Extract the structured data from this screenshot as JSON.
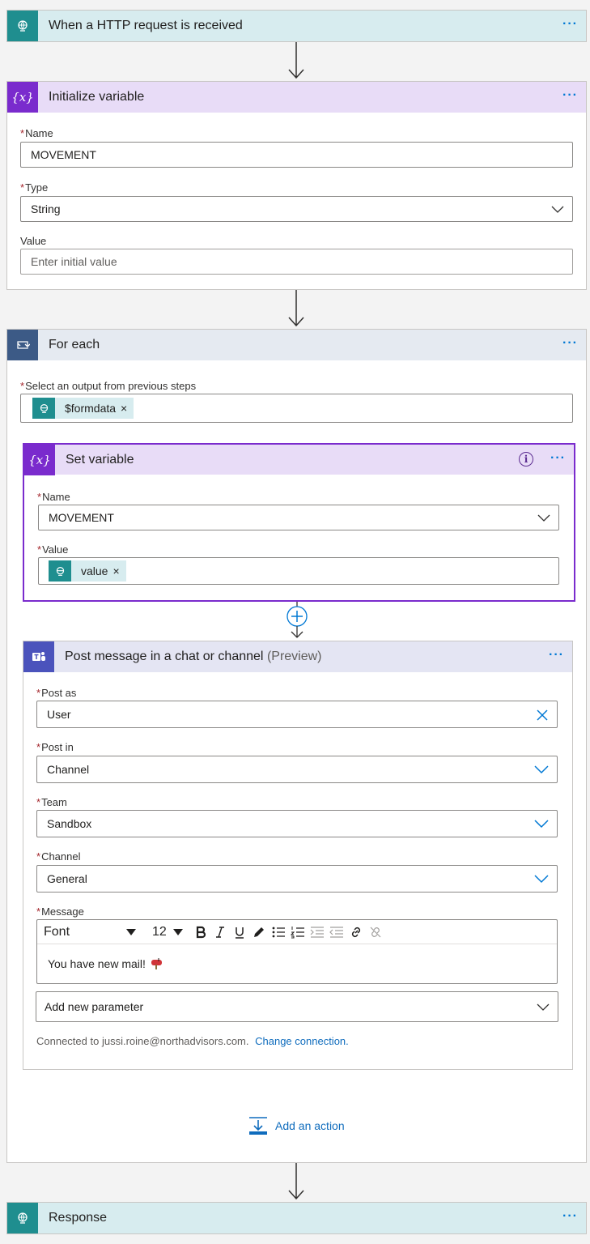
{
  "trigger": {
    "title": "When a HTTP request is received",
    "icon": "http-globe-icon"
  },
  "init_var": {
    "title": "Initialize variable",
    "icon_text": "{x}",
    "name_label": "Name",
    "name_value": "MOVEMENT",
    "type_label": "Type",
    "type_value": "String",
    "value_label": "Value",
    "value_placeholder": "Enter initial value"
  },
  "foreach": {
    "title": "For each",
    "select_label": "Select an output from previous steps",
    "token": "$formdata",
    "add_action": "Add an action"
  },
  "set_var": {
    "title": "Set variable",
    "icon_text": "{x}",
    "info": "i",
    "name_label": "Name",
    "name_value": "MOVEMENT",
    "value_label": "Value",
    "value_token": "value"
  },
  "post": {
    "title": "Post message in a chat or channel",
    "preview": "(Preview)",
    "post_as_label": "Post as",
    "post_as_value": "User",
    "post_in_label": "Post in",
    "post_in_value": "Channel",
    "team_label": "Team",
    "team_value": "Sandbox",
    "channel_label": "Channel",
    "channel_value": "General",
    "message_label": "Message",
    "font_label": "Font",
    "font_size": "12",
    "message_text": "You have new mail!",
    "add_param": "Add new parameter",
    "connected_text": "Connected to jussi.roine@northadvisors.com.",
    "change_connection": "Change connection."
  },
  "response": {
    "title": "Response"
  },
  "more_label": "···",
  "remove_token": "×",
  "colors": {
    "teal": "#1f8e8f",
    "purple": "#7a2bcd",
    "loop": "#3c5a86",
    "teams": "#4b53bc",
    "link": "#0f6cbd"
  }
}
